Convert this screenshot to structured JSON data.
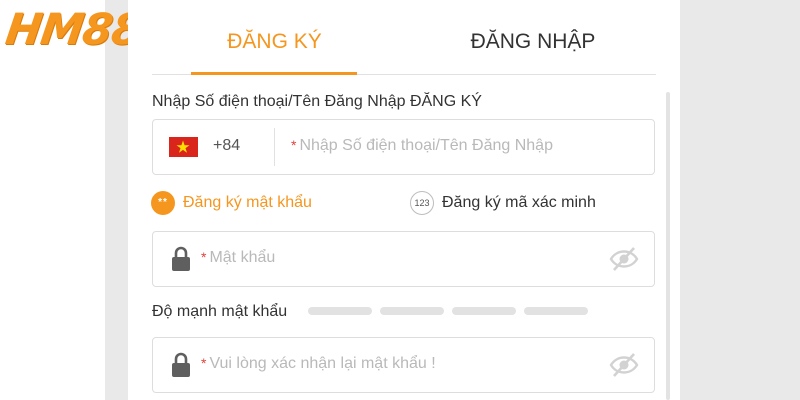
{
  "brand": {
    "logo_text": "HM88",
    "accent_color": "#f5961e"
  },
  "tabs": [
    {
      "label": "ĐĂNG KÝ",
      "active": true
    },
    {
      "label": "ĐĂNG NHẬP",
      "active": false
    }
  ],
  "form": {
    "phone": {
      "label": "Nhập Số điện thoại/Tên Đăng Nhập ĐĂNG KÝ",
      "country_code": "+84",
      "flag_icon": "vietnam-flag-icon",
      "required_mark": "*",
      "placeholder": "Nhập Số điện thoại/Tên Đăng Nhập"
    },
    "registration_methods": [
      {
        "label": "Đăng ký mật khẩu",
        "badge": "**",
        "selected": true
      },
      {
        "label": "Đăng ký mã xác minh",
        "badge": "123",
        "selected": false
      }
    ],
    "password": {
      "required_mark": "*",
      "placeholder": "Mật khẩu",
      "lock_icon": "lock-icon",
      "visibility_icon": "eye-off-icon"
    },
    "strength": {
      "label": "Độ mạnh mật khẩu",
      "segments": 4,
      "filled": 0
    },
    "confirm_password": {
      "required_mark": "*",
      "placeholder": "Vui lòng xác nhận lại mật khẩu !",
      "lock_icon": "lock-icon",
      "visibility_icon": "eye-off-icon"
    }
  }
}
